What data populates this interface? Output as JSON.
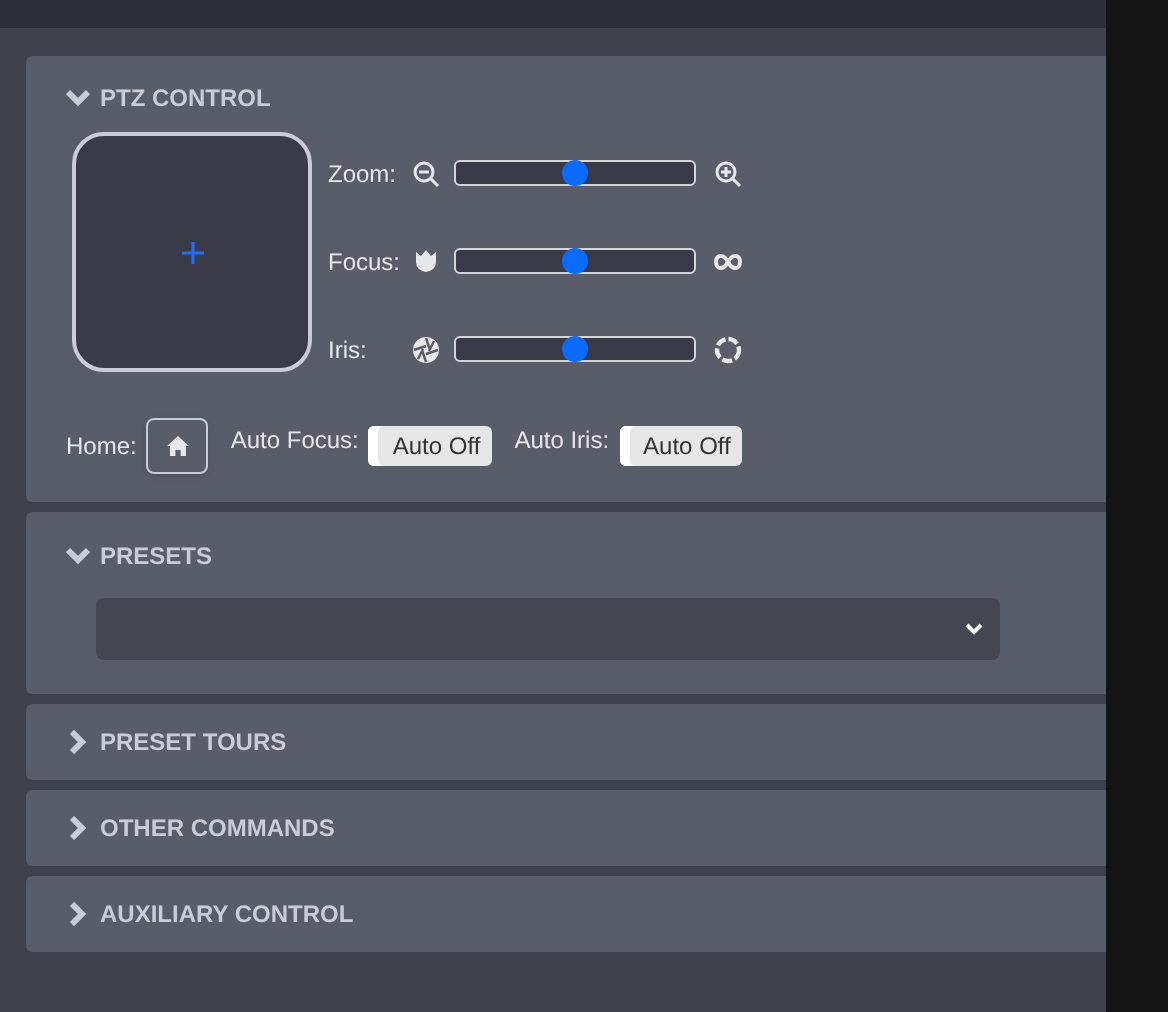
{
  "sections": [
    {
      "title": "PTZ CONTROL",
      "expanded": true,
      "kind": "ptz",
      "sliders": [
        {
          "label": "Zoom:",
          "kind": "zoom",
          "level": 0.5
        },
        {
          "label": "Focus:",
          "kind": "focus",
          "level": 0.5
        },
        {
          "label": "Iris:",
          "kind": "iris",
          "level": 0.5
        }
      ],
      "home_label": "Home:",
      "toggles": [
        {
          "label": "Auto Focus:",
          "text": "Auto Off",
          "on": false
        },
        {
          "label": "Auto Iris:",
          "text": "Auto Off",
          "on": false
        }
      ]
    },
    {
      "title": "PRESETS",
      "expanded": true,
      "kind": "presets"
    },
    {
      "title": "PRESET TOURS",
      "expanded": false
    },
    {
      "title": "OTHER COMMANDS",
      "expanded": false
    },
    {
      "title": "AUXILIARY CONTROL",
      "expanded": false
    }
  ]
}
